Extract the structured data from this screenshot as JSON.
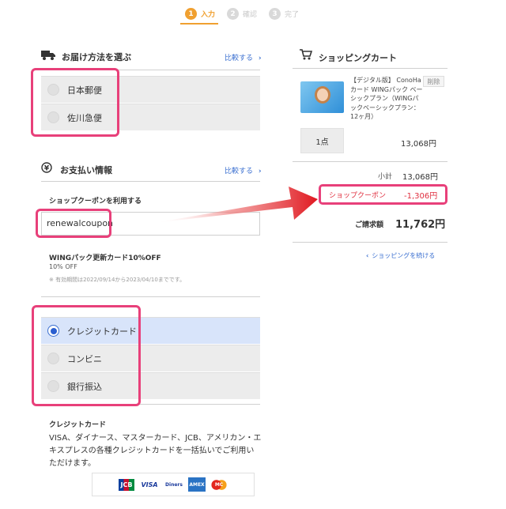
{
  "steps": [
    {
      "num": "1",
      "label": "入力"
    },
    {
      "num": "2",
      "label": "確認"
    },
    {
      "num": "3",
      "label": "完了"
    }
  ],
  "delivery": {
    "title": "お届け方法を選ぶ",
    "compare": "比較する",
    "options": [
      "日本郵便",
      "佐川急便"
    ]
  },
  "payment": {
    "title": "お支払い情報",
    "compare": "比較する",
    "coupon_label": "ショップクーポンを利用する",
    "coupon_value": "renewalcoupon",
    "coupon_name": "WINGパック更新カード10%OFF",
    "coupon_discount": "10% OFF",
    "coupon_note": "※ 有効期間は2022/09/14から2023/04/10までです。",
    "options": [
      "クレジットカード",
      "コンビニ",
      "銀行振込"
    ],
    "cc_title": "クレジットカード",
    "cc_desc_1": "VISA、ダイナース、マスターカード、JCB、アメリカン・エ",
    "cc_desc_2": "キスプレスの各種クレジットカードを一括払いでご利用い",
    "cc_desc_3": "ただけます。",
    "cards": [
      "JCB",
      "VISA",
      "Diners",
      "AMEX",
      "MC"
    ]
  },
  "cart": {
    "title": "ショッピングカート",
    "item_line1": "【デジタル版】 ConoHa",
    "item_line2": "カード WINGパック ベー",
    "item_line3": "シックプラン（WINGパ",
    "item_line4": "ックベーシックプラン：",
    "item_line5": "12ヶ月）",
    "delete": "削除",
    "qty": "1点",
    "item_price": "13,068円",
    "subtotal_label": "小計",
    "subtotal": "13,068円",
    "coupon_label": "ショップクーポン",
    "coupon_amount": "-1,306円",
    "total_label": "ご請求額",
    "total": "11,762円",
    "continue": "ショッピングを続ける"
  },
  "colors": {
    "accent": "#f0a030",
    "link": "#3a6fd0",
    "highlight": "#e8407a",
    "arrow": "#e01820"
  }
}
